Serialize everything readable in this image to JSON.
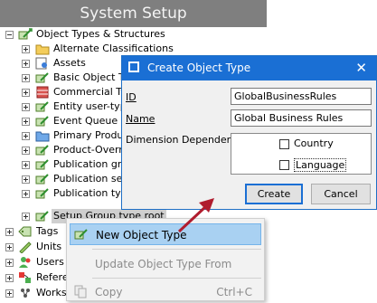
{
  "window": {
    "title": "System Setup"
  },
  "tree": {
    "items": [
      {
        "label": "Object Types & Structures",
        "icon": "object-type-icon"
      },
      {
        "label": "Alternate Classifications",
        "icon": "folder-icon"
      },
      {
        "label": "Assets",
        "icon": "asset-icon"
      },
      {
        "label": "Basic Object Ty",
        "icon": "object-type-icon"
      },
      {
        "label": "Commercial Typ",
        "icon": "commercial-type-icon"
      },
      {
        "label": "Entity user-type",
        "icon": "object-type-icon"
      },
      {
        "label": "Event Queue O",
        "icon": "object-type-icon"
      },
      {
        "label": "Primary Product",
        "icon": "blue-folder-icon"
      },
      {
        "label": "Product-Overrid",
        "icon": "object-type-icon"
      },
      {
        "label": "Publication grou",
        "icon": "object-type-icon"
      },
      {
        "label": "Publication secti",
        "icon": "object-type-icon"
      },
      {
        "label": "Publication type",
        "icon": "object-type-icon"
      },
      {
        "label": "Setup Group type root",
        "icon": "object-type-icon"
      },
      {
        "label": "Tags",
        "icon": "tags-icon"
      },
      {
        "label": "Units",
        "icon": "units-icon"
      },
      {
        "label": "Users",
        "icon": "users-icon"
      },
      {
        "label": "Refere",
        "icon": "references-icon"
      },
      {
        "label": "Works",
        "icon": "workspace-icon"
      }
    ]
  },
  "dialog": {
    "title": "Create Object Type",
    "close_label": "✕",
    "id_label": "ID",
    "id_value": "GlobalBusinessRules",
    "name_label": "Name",
    "name_value": "Global Business Rules",
    "dimension_label": "Dimension Dependency",
    "dimensions": [
      {
        "label": "Country",
        "checked": false
      },
      {
        "label": "Language",
        "checked": false
      }
    ],
    "create_label": "Create",
    "cancel_label": "Cancel"
  },
  "context_menu": {
    "items": [
      {
        "label": "New Object Type",
        "shortcut": "",
        "enabled": true,
        "highlighted": true
      },
      {
        "label": "Update Object Type From",
        "shortcut": "",
        "enabled": false
      },
      {
        "label": "Copy",
        "shortcut": "Ctrl+C",
        "enabled": false
      }
    ]
  },
  "colors": {
    "title_bar": "#7f7f7f",
    "dialog_title": "#1a6fd4",
    "menu_highlight": "#a9d1f2",
    "arrow": "#b01c2e"
  }
}
